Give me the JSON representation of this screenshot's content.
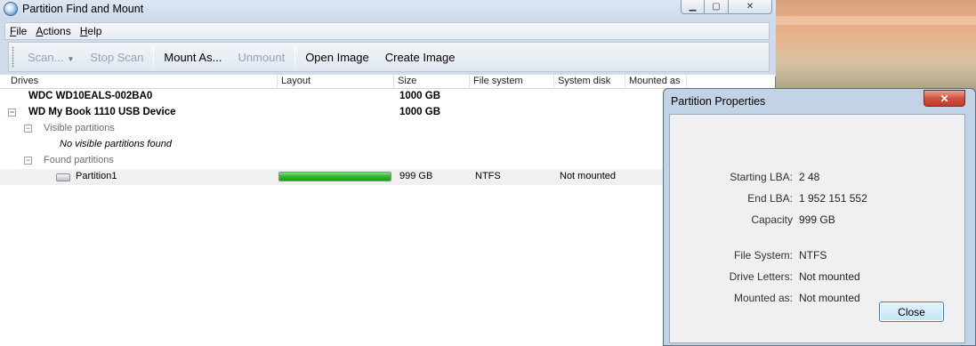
{
  "window": {
    "title": "Partition Find and Mount"
  },
  "menu": [
    {
      "label": "File",
      "underline": "F",
      "rest": "ile"
    },
    {
      "label": "Actions",
      "underline": "A",
      "rest": "ctions"
    },
    {
      "label": "Help",
      "underline": "H",
      "rest": "elp"
    }
  ],
  "toolbar": {
    "scan": "Scan...",
    "stop_scan": "Stop Scan",
    "mount_as": "Mount As...",
    "unmount": "Unmount",
    "open_image": "Open Image",
    "create_image": "Create Image"
  },
  "columns": [
    "Drives",
    "Layout",
    "Size",
    "File system",
    "System disk",
    "Mounted as"
  ],
  "rows": {
    "drive1": {
      "name": "WDC WD10EALS-002BA0",
      "size": "1000 GB"
    },
    "drive2": {
      "name": "WD My Book 1110 USB Device",
      "size": "1000 GB"
    },
    "visible_group": {
      "label": "Visible partitions"
    },
    "no_visible": {
      "label": "No visible partitions found"
    },
    "found_group": {
      "label": "Found partitions"
    },
    "partition1": {
      "name": "Partition1",
      "layout_fill": 1.0,
      "size": "999 GB",
      "file_system": "NTFS",
      "system_disk": "Not mounted"
    }
  },
  "dialog": {
    "title": "Partition Properties",
    "close_x": "✕",
    "properties": [
      {
        "label": "Starting LBA:",
        "value": "2 48"
      },
      {
        "label": "End LBA:",
        "value": "1 952 151 552"
      },
      {
        "label": "Capacity",
        "value": "999 GB"
      },
      {
        "label": "File System:",
        "value": "NTFS"
      },
      {
        "label": "Drive Letters:",
        "value": "Not mounted"
      },
      {
        "label": "Mounted as:",
        "value": "Not mounted"
      }
    ],
    "close_button": "Close"
  },
  "colors": {
    "progress": "#2fb52f",
    "accent": "#3c7fb1",
    "close_red": "#c2392a"
  },
  "icons": {
    "app": "app-icon",
    "disk": "disk-icon",
    "expand": "tree-collapse-icon"
  }
}
